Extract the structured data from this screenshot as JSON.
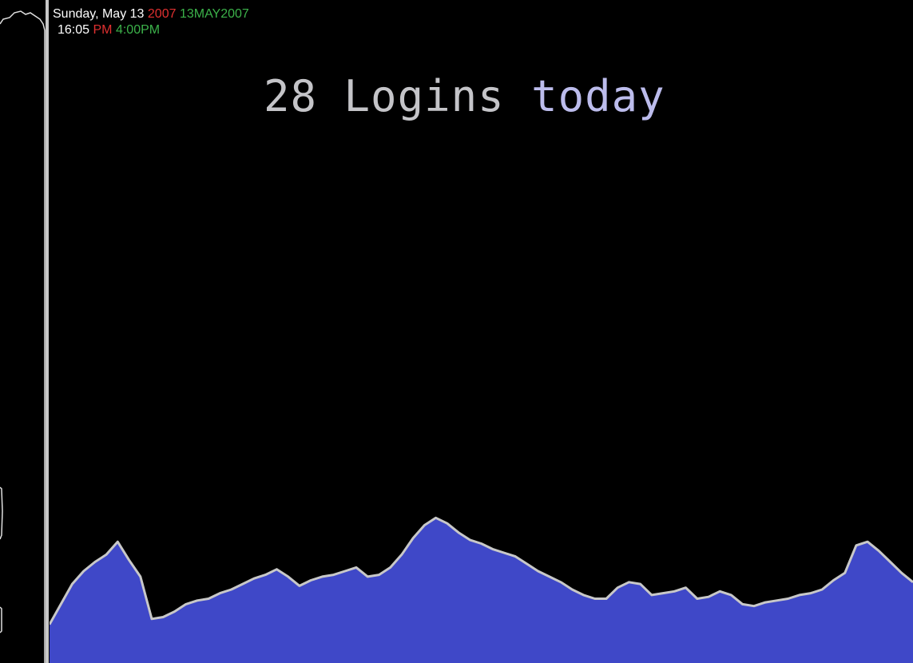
{
  "clock": {
    "day_date": "Sunday, May 13",
    "year": "2007",
    "date_code": "13MAY2007",
    "time": "16:05",
    "ampm": "PM",
    "time_alt": "4:00PM"
  },
  "headline": {
    "count": "28",
    "word": "Logins",
    "today": "today"
  },
  "colors": {
    "background": "#000000",
    "area_fill": "#3f48c8",
    "area_stroke": "#c8c8c8",
    "red": "#e03030",
    "green": "#3cb24a",
    "headline": "#c4c4c8",
    "headline_today": "#bcbcec"
  },
  "chart_data": {
    "type": "area",
    "title": "",
    "xlabel": "",
    "ylabel": "",
    "grid": false,
    "legend": "none",
    "ylim": [
      0,
      100
    ],
    "values": [
      21,
      32,
      43,
      50,
      55,
      59,
      66,
      56,
      47,
      24,
      25,
      28,
      32,
      34,
      35,
      38,
      40,
      43,
      46,
      48,
      51,
      47,
      42,
      45,
      47,
      48,
      50,
      52,
      47,
      48,
      52,
      59,
      68,
      75,
      79,
      76,
      71,
      67,
      65,
      62,
      60,
      58,
      54,
      50,
      47,
      44,
      40,
      37,
      35,
      35,
      41,
      44,
      43,
      37,
      38,
      39,
      41,
      35,
      36,
      39,
      37,
      32,
      31,
      33,
      34,
      35,
      37,
      38,
      40,
      45,
      49,
      64,
      66,
      61,
      55,
      49,
      44
    ]
  }
}
